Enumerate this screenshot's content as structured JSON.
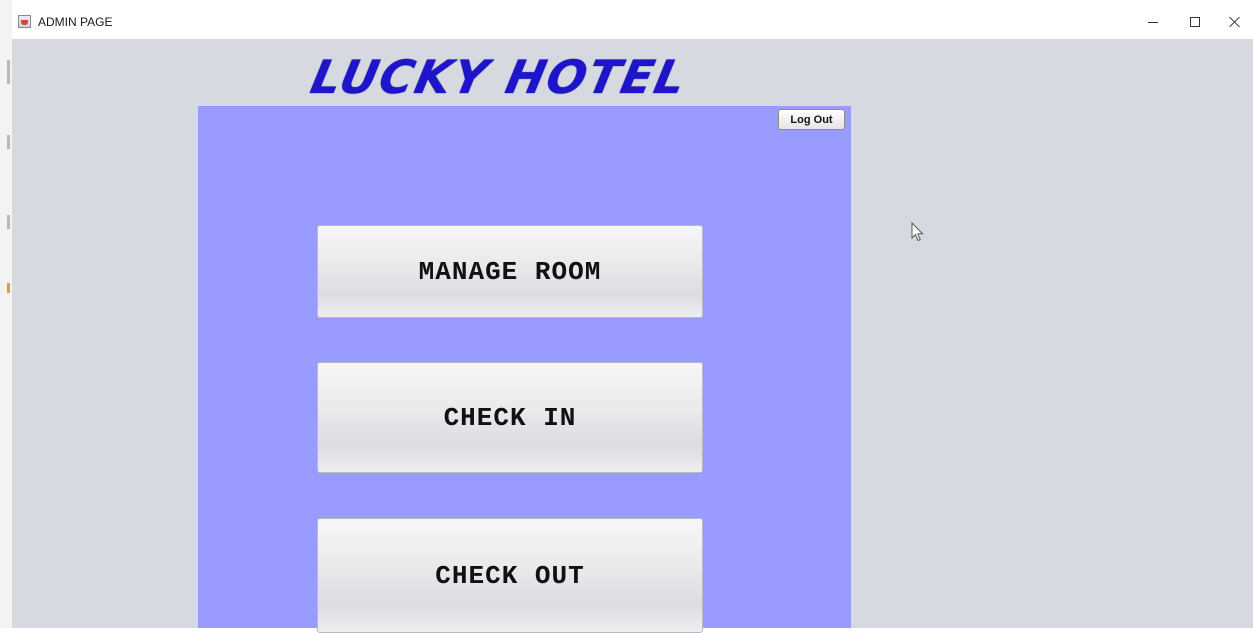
{
  "window": {
    "title": "ADMIN PAGE"
  },
  "header": {
    "logo_text": "LUCKY HOTEL"
  },
  "panel": {
    "logout_label": "Log Out",
    "buttons": {
      "manage_room": "MANAGE ROOM",
      "check_in": "CHECK IN",
      "check_out": "CHECK OUT"
    }
  },
  "colors": {
    "panel_background": "#9a9bfe",
    "logo_blue": "#1e14c9",
    "window_background": "#d6d9e0"
  },
  "icons": {
    "app": "java-app-icon",
    "minimize": "minimize-icon",
    "maximize": "maximize-icon",
    "close": "close-icon",
    "cursor": "mouse-pointer-icon"
  }
}
